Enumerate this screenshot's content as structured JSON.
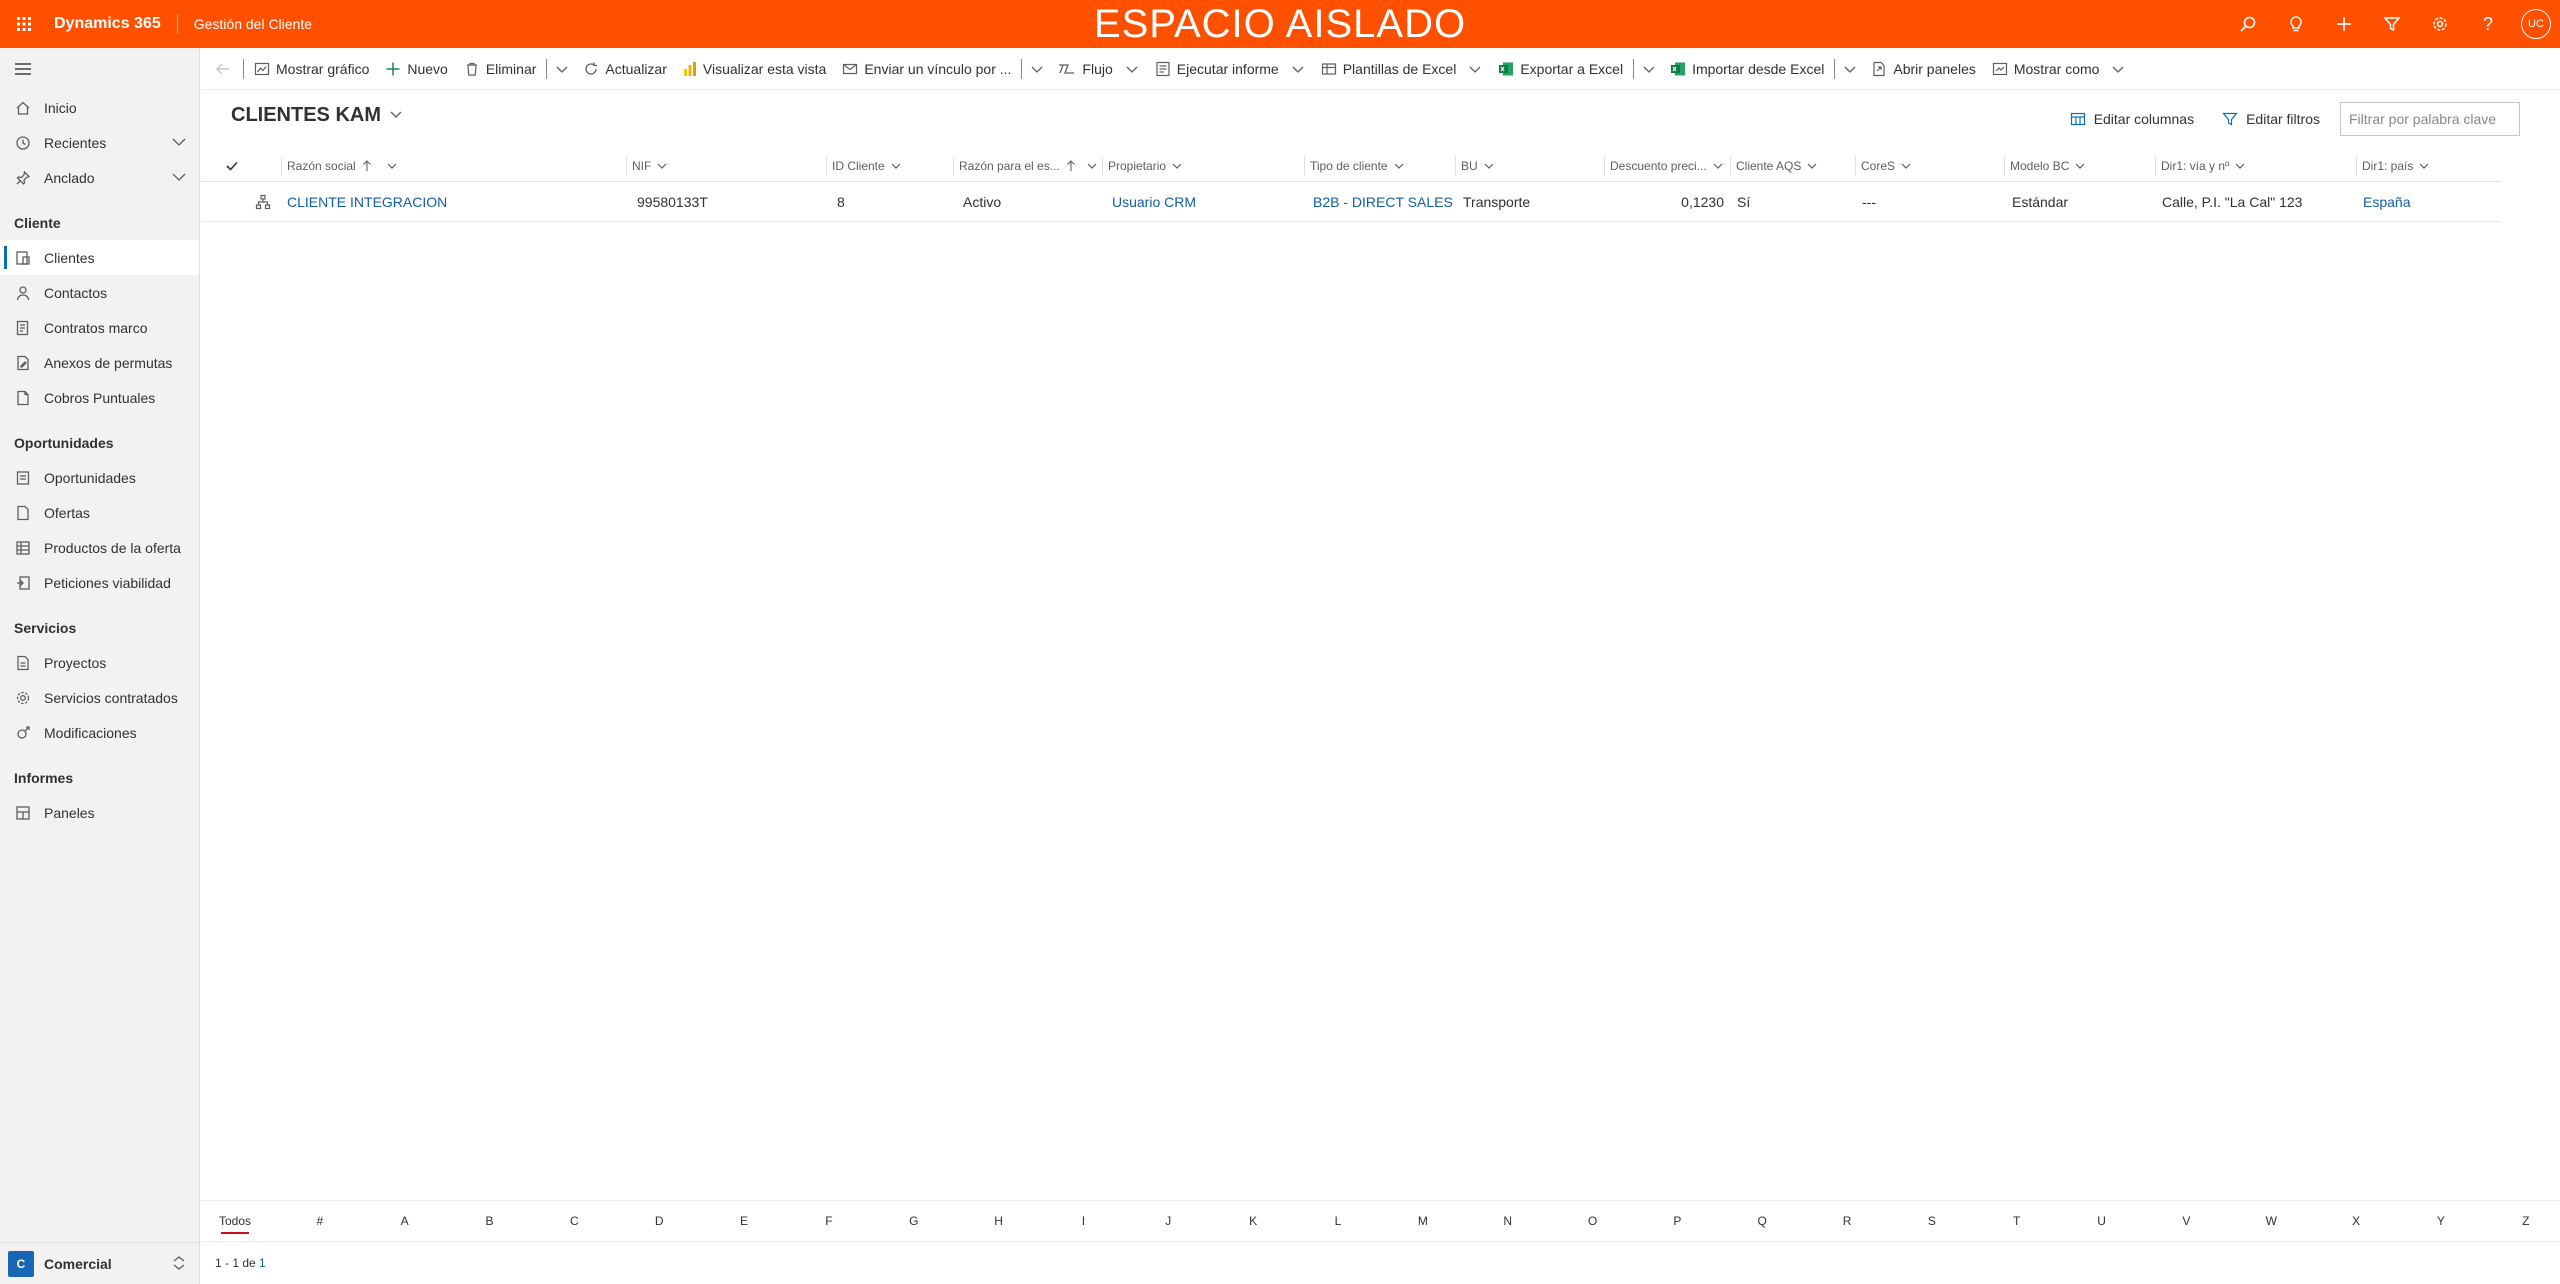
{
  "header": {
    "app_name": "Dynamics 365",
    "module_name": "Gestión del Cliente",
    "environment_banner": "ESPACIO AISLADO",
    "user_initials": "UC"
  },
  "sidebar": {
    "top_items": [
      {
        "label": "Inicio",
        "icon": "home-icon"
      },
      {
        "label": "Recientes",
        "icon": "clock-icon"
      },
      {
        "label": "Anclado",
        "icon": "pin-icon"
      }
    ],
    "groups": [
      {
        "title": "Cliente",
        "items": [
          {
            "label": "Clientes",
            "icon": "account-icon",
            "active": true
          },
          {
            "label": "Contactos",
            "icon": "person-icon"
          },
          {
            "label": "Contratos marco",
            "icon": "contract-icon"
          },
          {
            "label": "Anexos de permutas",
            "icon": "document-edit-icon"
          },
          {
            "label": "Cobros Puntuales",
            "icon": "document-icon"
          }
        ]
      },
      {
        "title": "Oportunidades",
        "items": [
          {
            "label": "Oportunidades",
            "icon": "opportunity-icon"
          },
          {
            "label": "Ofertas",
            "icon": "quote-icon"
          },
          {
            "label": "Productos de la oferta",
            "icon": "product-list-icon"
          },
          {
            "label": "Peticiones viabilidad",
            "icon": "request-icon"
          }
        ]
      },
      {
        "title": "Servicios",
        "items": [
          {
            "label": "Proyectos",
            "icon": "project-icon"
          },
          {
            "label": "Servicios contratados",
            "icon": "service-icon"
          },
          {
            "label": "Modificaciones",
            "icon": "modify-icon"
          }
        ]
      },
      {
        "title": "Informes",
        "items": [
          {
            "label": "Paneles",
            "icon": "dashboard-icon"
          }
        ]
      }
    ],
    "area": {
      "badge": "C",
      "name": "Comercial"
    }
  },
  "commands": {
    "show_chart": "Mostrar gráfico",
    "new": "Nuevo",
    "delete": "Eliminar",
    "refresh": "Actualizar",
    "visualize_view": "Visualizar esta vista",
    "send_link": "Enviar un vínculo por ...",
    "flow": "Flujo",
    "run_report": "Ejecutar informe",
    "excel_templates": "Plantillas de Excel",
    "export_excel": "Exportar a Excel",
    "import_excel": "Importar desde Excel",
    "open_dashboards": "Abrir paneles",
    "show_as": "Mostrar como"
  },
  "view": {
    "title": "CLIENTES KAM",
    "edit_columns": "Editar columnas",
    "edit_filters": "Editar filtros",
    "filter_placeholder": "Filtrar por palabra clave"
  },
  "grid": {
    "columns": [
      "Razón social",
      "NIF",
      "ID Cliente",
      "Razón para el es...",
      "Propietario",
      "Tipo de cliente",
      "BU",
      "Descuento preci...",
      "Cliente AQS",
      "CoreS",
      "Modelo BC",
      "Dir1: vía y nº",
      "Dir1: país"
    ],
    "rows": [
      [
        "CLIENTE INTEGRACION",
        "99580133T",
        "8",
        "Activo",
        "Usuario CRM",
        "B2B - DIRECT SALES",
        "Transporte",
        "0,1230",
        "Sí",
        "---",
        "Estándar",
        "Calle, P.I. \"La Cal\" 123",
        "España"
      ]
    ]
  },
  "jumpbar": [
    "Todos",
    "#",
    "A",
    "B",
    "C",
    "D",
    "E",
    "F",
    "G",
    "H",
    "I",
    "J",
    "K",
    "L",
    "M",
    "N",
    "O",
    "P",
    "Q",
    "R",
    "S",
    "T",
    "U",
    "V",
    "W",
    "X",
    "Y",
    "Z"
  ],
  "footer": {
    "range": "1 - 1 de ",
    "total": "1"
  },
  "colors": {
    "topbar": "#ff5000",
    "link": "#115ea3",
    "active_indicator": "#0f6cbd",
    "excel_green": "#107c41"
  }
}
